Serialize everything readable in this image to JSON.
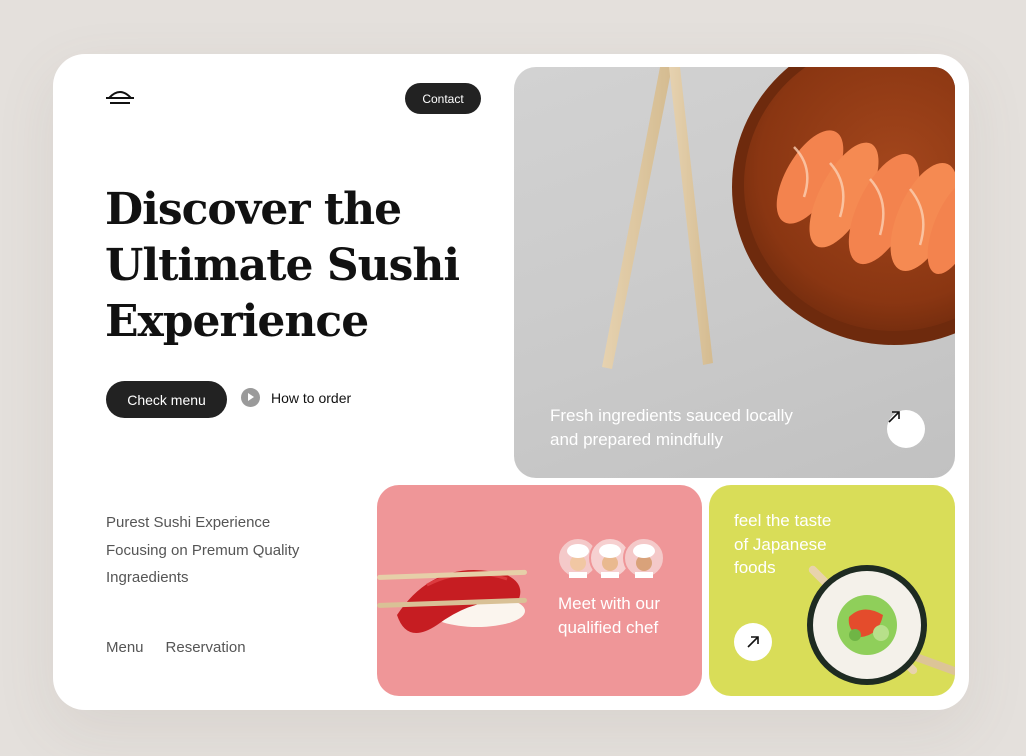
{
  "header": {
    "logo_icon": "sushi-bowl-icon",
    "contact_label": "Contact"
  },
  "hero": {
    "headline_lines": [
      "Discover the",
      "Ultimate Sushi",
      "Experience"
    ],
    "check_menu_label": "Check menu",
    "how_to_order_label": "How to order",
    "play_icon": "play-icon"
  },
  "features": {
    "lines": [
      "Purest Sushi Experience",
      "Focusing on Premum Quality",
      "Ingraedients"
    ]
  },
  "footer_nav": {
    "menu_label": "Menu",
    "reservation_label": "Reservation"
  },
  "hero_image": {
    "caption_lines": [
      "Fresh ingredients sauced locally",
      "and prepared mindfully"
    ],
    "arrow_icon": "arrow-up-right-icon"
  },
  "chef_card": {
    "text_lines": [
      "Meet with our",
      "qualified chef"
    ],
    "avatars": [
      "chef-avatar-1",
      "chef-avatar-2",
      "chef-avatar-3"
    ],
    "background": "#ef9698"
  },
  "taste_card": {
    "text_lines": [
      "feel the taste",
      "of Japanese",
      "foods"
    ],
    "arrow_icon": "arrow-up-right-icon",
    "background": "#d9dd58"
  },
  "colors": {
    "page_background": "#e4e0dc",
    "dark_button": "#222222",
    "salmon": "#f3834e"
  }
}
